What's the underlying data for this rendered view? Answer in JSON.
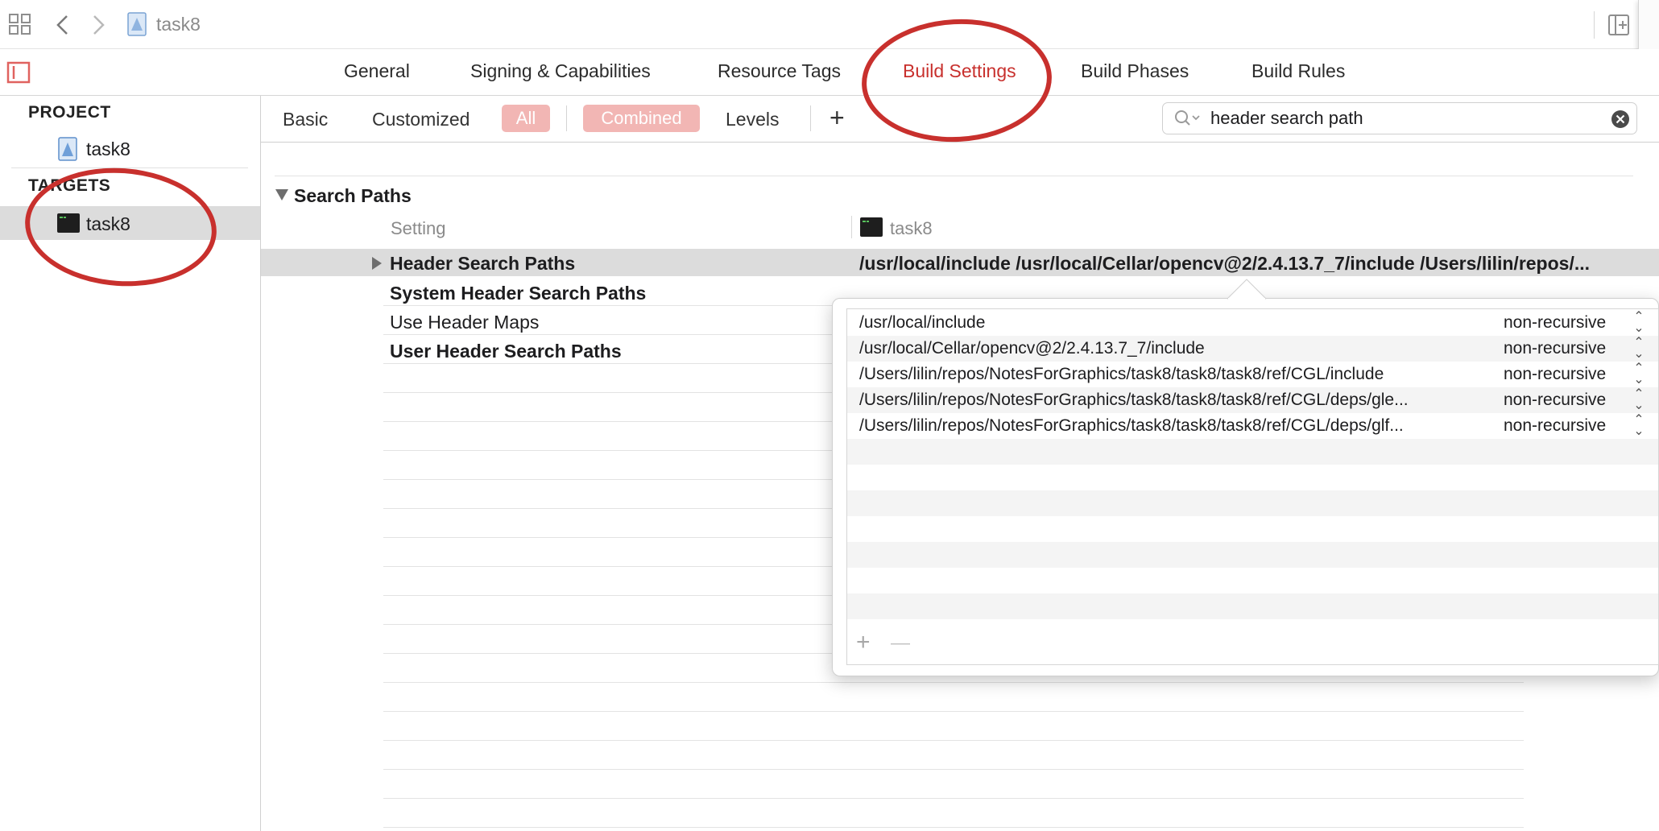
{
  "toolbar": {
    "file_name": "task8"
  },
  "tabs": [
    {
      "label": "General"
    },
    {
      "label": "Signing & Capabilities"
    },
    {
      "label": "Resource Tags"
    },
    {
      "label": "Build Settings",
      "active": true
    },
    {
      "label": "Build Phases"
    },
    {
      "label": "Build Rules"
    }
  ],
  "sidebar": {
    "project_header": "PROJECT",
    "project_item": "task8",
    "targets_header": "TARGETS",
    "target_item": "task8"
  },
  "filters": {
    "basic": "Basic",
    "customized": "Customized",
    "all": "All",
    "combined": "Combined",
    "levels": "Levels",
    "add": "+"
  },
  "search": {
    "value": "header search path"
  },
  "section": {
    "title": "Search Paths",
    "col_setting": "Setting",
    "col_target": "task8"
  },
  "settings": [
    {
      "name": "Header Search Paths",
      "value": "/usr/local/include /usr/local/Cellar/opencv@2/2.4.13.7_7/include /Users/lilin/repos/..."
    },
    {
      "name": "System Header Search Paths"
    },
    {
      "name": "Use Header Maps"
    },
    {
      "name": "User Header Search Paths"
    }
  ],
  "popover": {
    "paths": [
      {
        "path": "/usr/local/include",
        "mode": "non-recursive"
      },
      {
        "path": "/usr/local/Cellar/opencv@2/2.4.13.7_7/include",
        "mode": "non-recursive"
      },
      {
        "path": "/Users/lilin/repos/NotesForGraphics/task8/task8/task8/ref/CGL/include",
        "mode": "non-recursive"
      },
      {
        "path": "/Users/lilin/repos/NotesForGraphics/task8/task8/task8/ref/CGL/deps/gle...",
        "mode": "non-recursive"
      },
      {
        "path": "/Users/lilin/repos/NotesForGraphics/task8/task8/task8/ref/CGL/deps/glf...",
        "mode": "non-recursive"
      }
    ],
    "add_label": "+",
    "remove_label": "—"
  },
  "colors": {
    "accent": "#c8302d",
    "pill": "#f2b6b4",
    "selected_row": "#dcdcdc"
  }
}
